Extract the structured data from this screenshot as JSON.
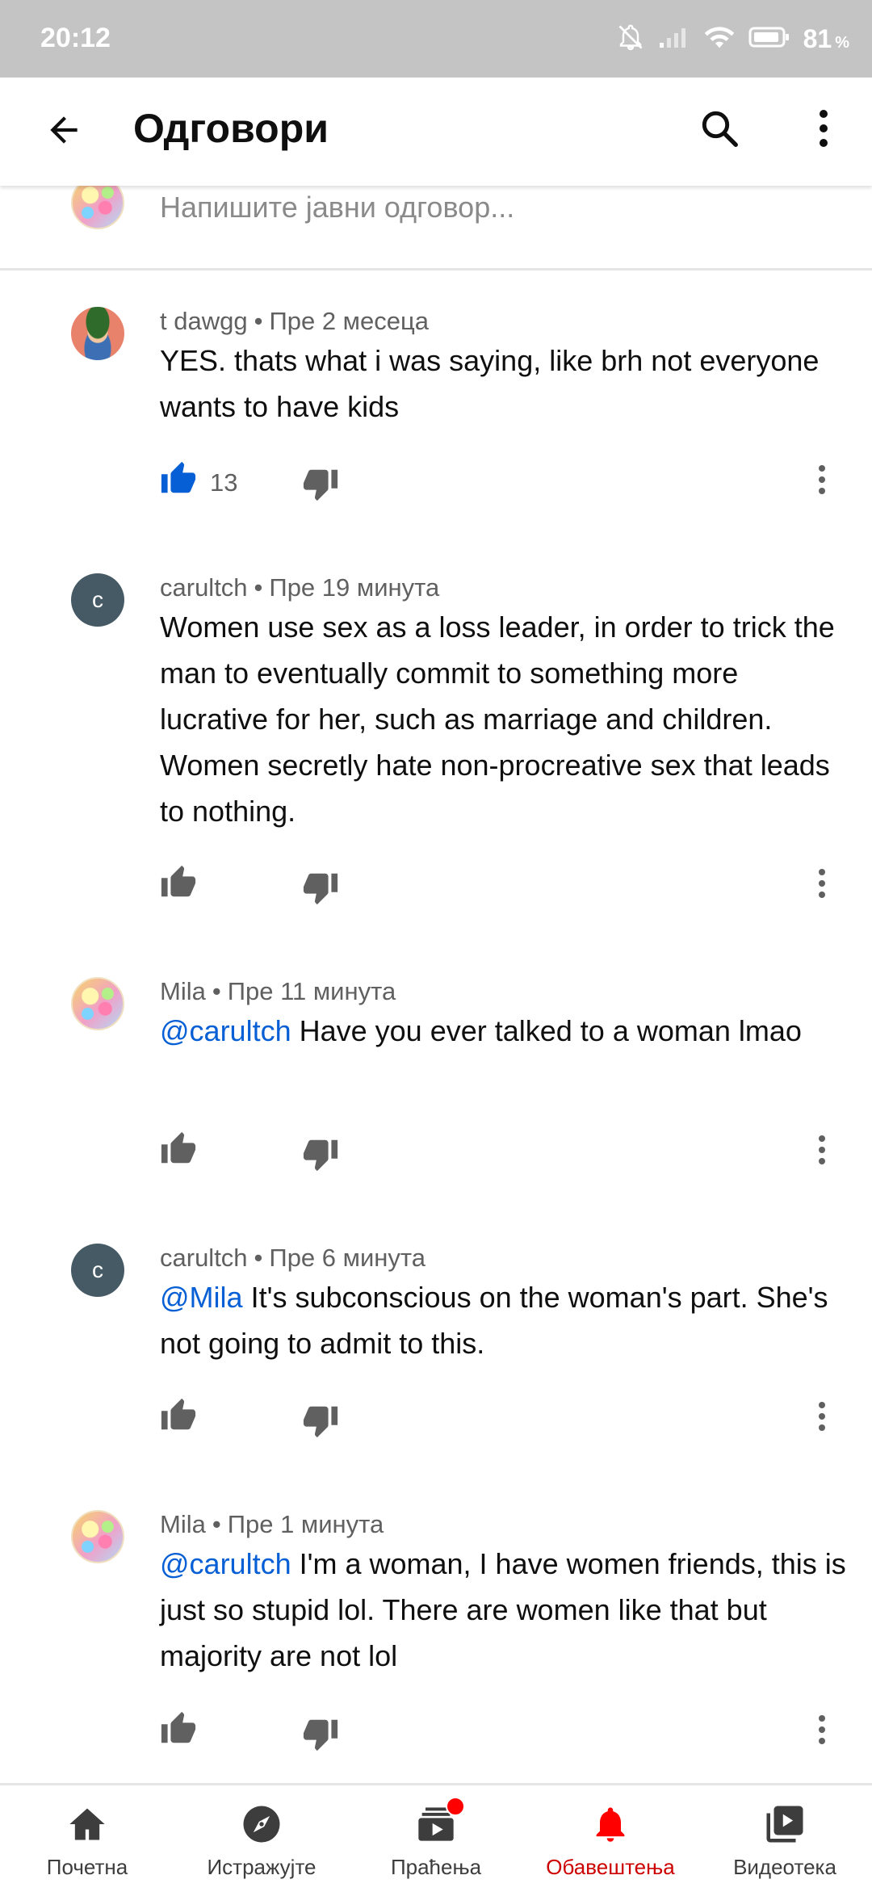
{
  "status_bar": {
    "time": "20:12",
    "battery_percent": "81",
    "battery_unit": "%"
  },
  "app_bar": {
    "title": "Одговори",
    "back_icon": "arrow-back-icon",
    "search_icon": "search-icon",
    "more_icon": "more-vert-icon"
  },
  "composer": {
    "placeholder": "Напишите јавни одговор..."
  },
  "comments": [
    {
      "author": "t dawgg",
      "time": "Пре 2 месеца",
      "mention": "",
      "text": "YES. thats what i was saying, like brh not everyone wants to have kids",
      "likes": "13",
      "liked": true
    },
    {
      "author": "carultch",
      "avatar_letter": "c",
      "time": "Пре 19 минута",
      "mention": "",
      "text": "Women use sex as a loss leader, in order to trick the man to eventually commit to something more lucrative for her, such as marriage and children.   Women secretly hate non-procreative sex that leads to nothing.",
      "likes": "",
      "liked": false
    },
    {
      "author": "Mila",
      "time": "Пре 11 минута",
      "mention": "@carultch",
      "text": " Have you ever talked to a woman lmao",
      "likes": "",
      "liked": false
    },
    {
      "author": "carultch",
      "avatar_letter": "c",
      "time": "Пре 6 минута",
      "mention": "@Mila",
      "text": " It's subconscious on the woman's part. She's not going to admit to this.",
      "likes": "",
      "liked": false
    },
    {
      "author": "Mila",
      "time": "Пре 1 минута",
      "mention": "@carultch",
      "text": " I'm a woman, I have women friends, this is just so stupid lol. There are women like that but majority are not lol",
      "likes": "",
      "liked": false
    }
  ],
  "bottom_nav": {
    "items": [
      {
        "label": "Почетна",
        "icon": "home-icon"
      },
      {
        "label": "Истражујте",
        "icon": "explore-icon"
      },
      {
        "label": "Праћења",
        "icon": "subscriptions-icon"
      },
      {
        "label": "Обавештења",
        "icon": "bell-icon"
      },
      {
        "label": "Видеотека",
        "icon": "library-icon"
      }
    ],
    "active_index": 3
  },
  "colors": {
    "accent_blue": "#065fd4",
    "active_red": "#cc0000",
    "status_bar": "#c4c4c4"
  }
}
